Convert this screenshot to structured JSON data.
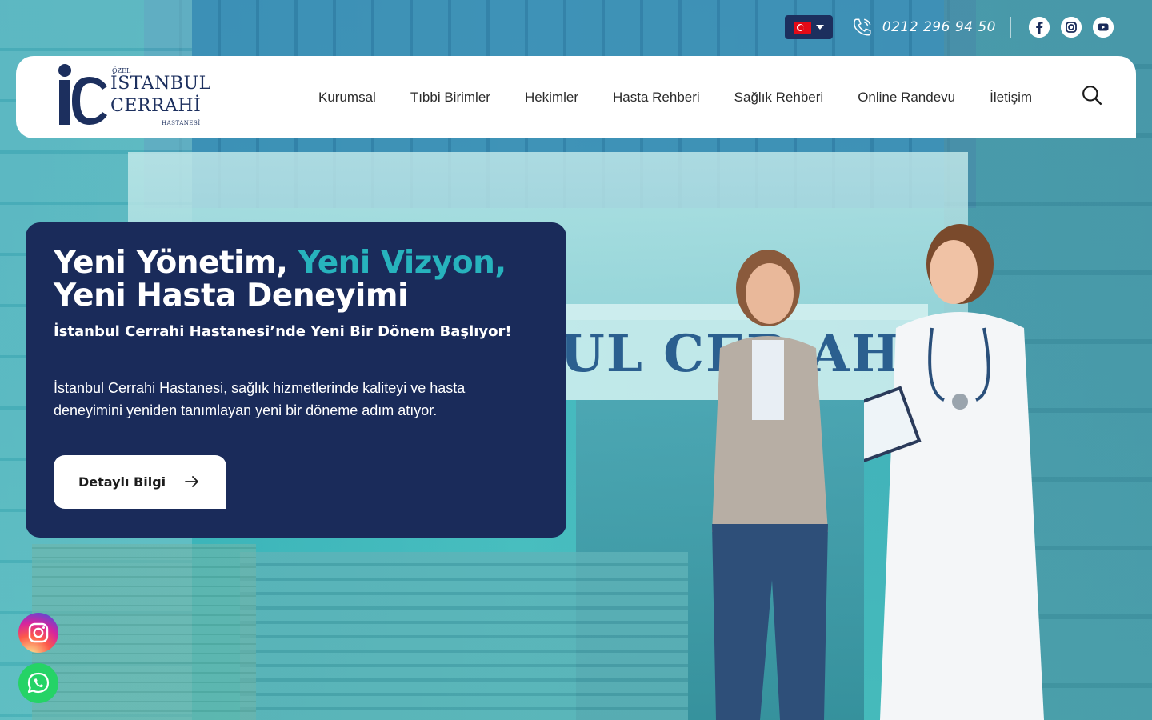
{
  "topbar": {
    "language_flag": "turkey-flag",
    "phone": "0212 296 94 50",
    "socials": [
      "facebook-icon",
      "instagram-icon",
      "youtube-icon"
    ]
  },
  "header": {
    "logo": {
      "ozel": "ÖZEL",
      "line1": "İSTANBUL",
      "line2": "CERRAHİ",
      "sub": "HASTANESİ"
    },
    "nav": [
      {
        "label": "Kurumsal"
      },
      {
        "label": "Tıbbi Birimler"
      },
      {
        "label": "Hekimler"
      },
      {
        "label": "Hasta Rehberi"
      },
      {
        "label": "Sağlık Rehberi"
      },
      {
        "label": "Online Randevu"
      },
      {
        "label": "İletişim"
      }
    ]
  },
  "hero": {
    "title_part1": "Yeni Yönetim, ",
    "title_accent": "Yeni Vizyon,",
    "title_line2": "Yeni Hasta Deneyimi",
    "subtitle": "İstanbul Cerrahi Hastanesi’nde Yeni Bir Dönem Başlıyor!",
    "description": "İstanbul Cerrahi Hastanesi, sağlık hizmetlerinde kaliteyi ve hasta deneyimini yeniden tanımlayan yeni bir döneme adım atıyor.",
    "cta_label": "Detaylı Bilgi",
    "background_sign": "UL CER  AHİ"
  },
  "colors": {
    "navy": "#1a2b5a",
    "accent": "#27b3bd",
    "white": "#ffffff"
  }
}
